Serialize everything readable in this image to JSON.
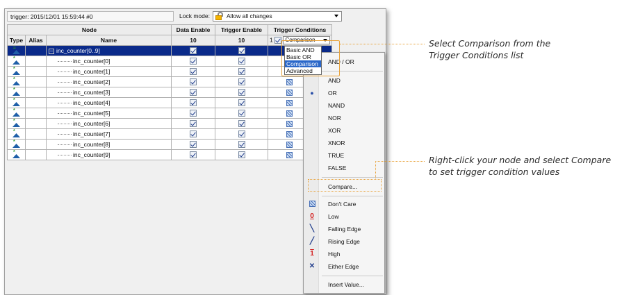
{
  "topbar": {
    "trigger_text": "trigger: 2015/12/01 15:59:44  #0",
    "lock_label": "Lock mode:",
    "lock_value": "Allow all changes"
  },
  "table": {
    "col_node": "Node",
    "col_data_enable": "Data Enable",
    "col_trigger_enable": "Trigger Enable",
    "col_trigger_conditions": "Trigger Conditions",
    "sub_type": "Type",
    "sub_alias": "Alias",
    "sub_name": "Name",
    "sub_data_enable_count": "10",
    "sub_trigger_enable_count": "10",
    "sub_cond_prefix": "1",
    "cond_select_value": "Comparison",
    "rows": [
      {
        "name": "inc_counter[0..9]"
      },
      {
        "name": "inc_counter[0]"
      },
      {
        "name": "inc_counter[1]"
      },
      {
        "name": "inc_counter[2]"
      },
      {
        "name": "inc_counter[3]"
      },
      {
        "name": "inc_counter[4]"
      },
      {
        "name": "inc_counter[5]"
      },
      {
        "name": "inc_counter[6]"
      },
      {
        "name": "inc_counter[7]"
      },
      {
        "name": "inc_counter[8]"
      },
      {
        "name": "inc_counter[9]"
      }
    ]
  },
  "dropdown_options": [
    "Basic AND",
    "Basic OR",
    "Comparison",
    "Advanced"
  ],
  "context_menu": {
    "and_or": "AND / OR",
    "and": "AND",
    "or": "OR",
    "nand": "NAND",
    "nor": "NOR",
    "xor": "XOR",
    "xnor": "XNOR",
    "true": "TRUE",
    "false": "FALSE",
    "compare": "Compare...",
    "dont_care": "Don't Care",
    "low": "Low",
    "falling_edge": "Falling Edge",
    "rising_edge": "Rising Edge",
    "high": "High",
    "either_edge": "Either Edge",
    "insert_value": "Insert Value..."
  },
  "callouts": {
    "top_line1": "Select Comparison from the",
    "top_line2": "Trigger Conditions list",
    "bottom_line1": "Right-click your node and select Compare",
    "bottom_line2": "to set trigger condition values"
  },
  "colors": {
    "accent_highlight": "#e8a23a",
    "selected_row": "#0a2a8a",
    "dropdown_highlight": "#2a67c9"
  }
}
